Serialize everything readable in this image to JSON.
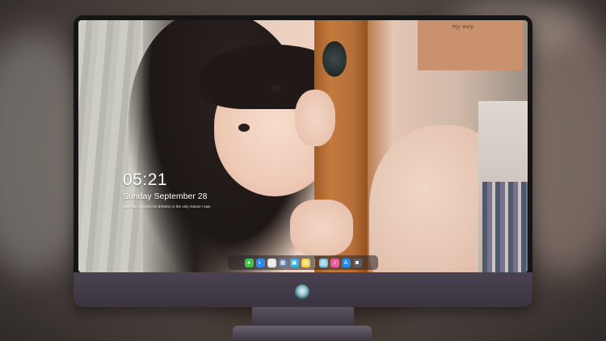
{
  "desktop": {
    "time": "05:21",
    "date": "Sunday September  28",
    "quote": "Rebellion poured into dreams, is the only reason I saw"
  },
  "wallpaper": {
    "poster_text": "my way"
  },
  "dock": {
    "items": [
      {
        "icon": "messages-icon",
        "glyph": "●",
        "color": "#3ec44a"
      },
      {
        "icon": "finder-icon",
        "glyph": "◐",
        "color": "#2e8be8"
      },
      {
        "icon": "clock-icon",
        "glyph": "◷",
        "color": "#e6e6e6"
      },
      {
        "icon": "photos-app-icon",
        "glyph": "▦",
        "color": "#6a7fa8"
      },
      {
        "icon": "launcher-icon",
        "glyph": "▣",
        "color": "#2fb2ea"
      },
      {
        "icon": "notes-icon",
        "glyph": "▤",
        "color": "#f4d34a"
      },
      {
        "icon": "preview-icon",
        "glyph": "▧",
        "color": "#7ec8e3"
      },
      {
        "icon": "music-icon",
        "glyph": "♫",
        "color": "#ec5aa0"
      },
      {
        "icon": "app-store-icon",
        "glyph": "A",
        "color": "#1d8cf2"
      },
      {
        "icon": "camera-icon",
        "glyph": "◙",
        "color": "#5a5f66"
      }
    ]
  }
}
